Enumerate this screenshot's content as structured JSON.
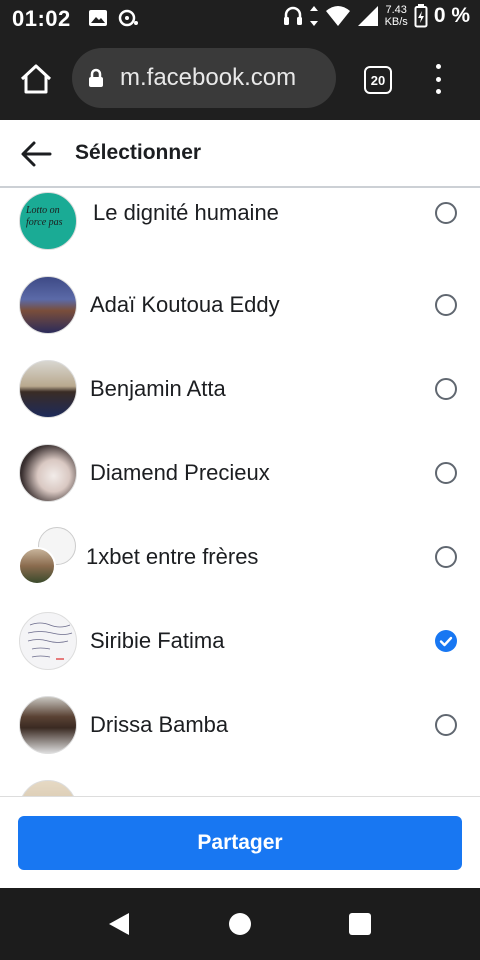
{
  "status_bar": {
    "time": "01:02",
    "net_speed_value": "7.43",
    "net_speed_unit": "KB/s",
    "battery_percent": "0 %"
  },
  "browser": {
    "url": "m.facebook.com",
    "tab_count": "20"
  },
  "header": {
    "title": "Sélectionner"
  },
  "list": {
    "items": [
      {
        "name": "Le dignité humaine",
        "selected": false,
        "avatar_text": "Lotto on force pas"
      },
      {
        "name": "Adaï Koutoua Eddy",
        "selected": false
      },
      {
        "name": "Benjamin Atta",
        "selected": false
      },
      {
        "name": "Diamend Precieux",
        "selected": false
      },
      {
        "name": "1xbet entre frères",
        "selected": false
      },
      {
        "name": "Siribie Fatima",
        "selected": true
      },
      {
        "name": "Drissa Bamba",
        "selected": false
      }
    ]
  },
  "footer": {
    "share_label": "Partager"
  },
  "colors": {
    "accent": "#1877f2",
    "status_bar_bg": "#1f1f1f",
    "url_box_bg": "#3a3a3a"
  },
  "icons": [
    "image-icon",
    "cloud-sync-icon",
    "headphones-icon",
    "data-arrows-icon",
    "wifi-icon",
    "signal-icon",
    "battery-icon",
    "home-icon",
    "lock-icon",
    "overflow-menu-icon",
    "back-arrow-icon",
    "check-icon"
  ]
}
